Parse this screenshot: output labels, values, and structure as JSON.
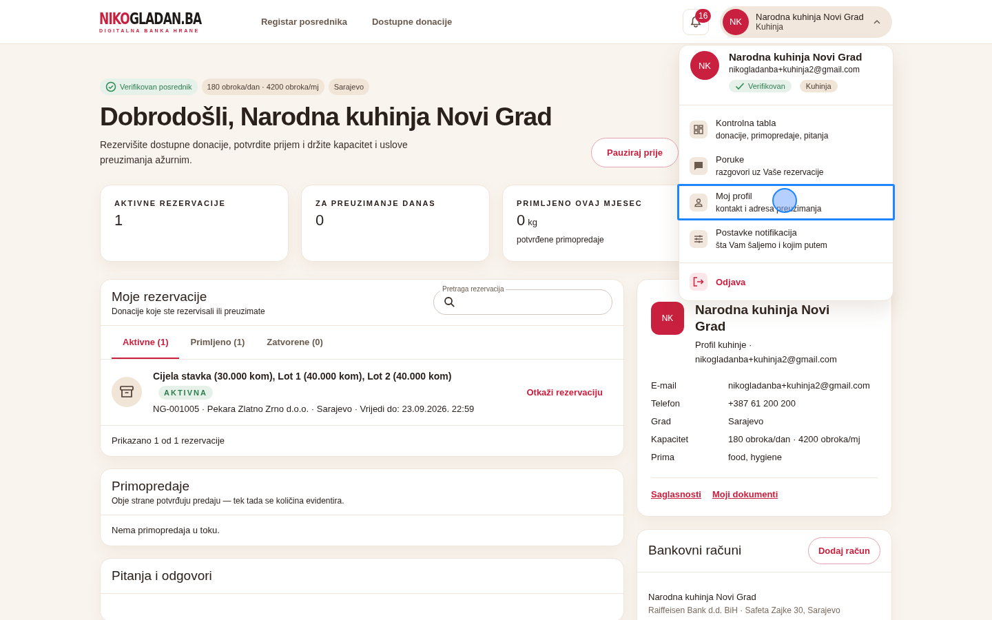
{
  "header": {
    "logo_dark": "NIKO",
    "logo_light": "GLADAN.BA",
    "logo_tagline": "DIGITALNA BANKA HRANE",
    "nav": [
      "Registar posrednika",
      "Dostupne donacije"
    ],
    "notifications_count": "16",
    "account": {
      "initials": "NK",
      "name": "Narodna kuhinja Novi Grad",
      "role": "Kuhinja",
      "expanded": true
    }
  },
  "hero": {
    "badges": [
      {
        "kind": "verified",
        "text": "Verifikovan posrednik"
      },
      {
        "kind": "plain",
        "text": "180 obroka/dan · 4200 obroka/mj"
      },
      {
        "kind": "plain",
        "text": "Sarajevo"
      }
    ],
    "title": "Dobrodošli, Narodna kuhinja Novi Grad",
    "subtitle": "Rezervišite dostupne donacije, potvrdite prijem i držite kapacitet i uslove preuzimanja ažurnim.",
    "button": "Pauziraj prije"
  },
  "stats": [
    {
      "label": "AKTIVNE REZERVACIJE",
      "value": "1"
    },
    {
      "label": "ZA PREUZIMANJE DANAS",
      "value": "0"
    },
    {
      "label": "PRIMLJENO OVAJ MJESEC",
      "value": "0",
      "unit": "kg",
      "note": "potvrđene primopredaje"
    }
  ],
  "reservations": {
    "title": "Moje rezervacije",
    "subtitle": "Donacije koje ste rezervisali ili preuzimate",
    "search": {
      "label": "Pretraga rezervacija"
    },
    "tabs": [
      {
        "label": "Aktivne (1)",
        "selected": true
      },
      {
        "label": "Primljeno (1)",
        "selected": false
      },
      {
        "label": "Zatvorene (0)",
        "selected": false
      }
    ],
    "items": [
      {
        "title": "Cijela stavka (30.000 kom), Lot 1 (40.000 kom), Lot 2 (40.000 kom)",
        "status": "AKTIVNA",
        "meta": "NG-001005 · Pekara Zlatno Zrno d.o.o. · Sarajevo · Vrijedi do: 23.09.2026. 22:59",
        "action": "Otkaži rezervaciju"
      }
    ],
    "footer": "Prikazano 1 od 1 rezervacije"
  },
  "handovers": {
    "title": "Primopredaje",
    "subtitle": "Obje strane potvrđuju predaju — tek tada se količina evidentira.",
    "empty": "Nema primopredaja u toku."
  },
  "qa": {
    "title": "Pitanja i odgovori"
  },
  "profile": {
    "initials": "NK",
    "name": "Narodna kuhinja Novi Grad",
    "subtitle": "Profil kuhinje · nikogladanba+kuhinja2@gmail.com",
    "fields": [
      {
        "label": "E-mail",
        "value": "nikogladanba+kuhinja2@gmail.com"
      },
      {
        "label": "Telefon",
        "value": "+387 61 200 200"
      },
      {
        "label": "Grad",
        "value": "Sarajevo"
      },
      {
        "label": "Kapacitet",
        "value": "180 obroka/dan · 4200 obroka/mj"
      },
      {
        "label": "Prima",
        "value": "food, hygiene"
      }
    ],
    "links": [
      "Saglasnosti",
      "Moji dokumenti"
    ]
  },
  "bank": {
    "title": "Bankovni računi",
    "button": "Dodaj račun",
    "accounts": [
      {
        "name": "Narodna kuhinja Novi Grad",
        "details": "Raiffeisen Bank d.d. BiH · Safeta Zajke 30, Sarajevo"
      }
    ]
  },
  "menu": {
    "initials": "NK",
    "name": "Narodna kuhinja Novi Grad",
    "email": "nikogladanba+kuhinja2@gmail.com",
    "badges": [
      {
        "kind": "verified",
        "text": "Verifikovan"
      },
      {
        "kind": "plain",
        "text": "Kuhinja"
      }
    ],
    "items": [
      {
        "kind": "dashboard",
        "label": "Kontrolna tabla",
        "hint": "donacije, primopredaje, pitanja",
        "selected": false
      },
      {
        "kind": "messages",
        "label": "Poruke",
        "hint": "razgovori uz Vaše rezervacije",
        "selected": false
      },
      {
        "kind": "profile",
        "label": "Moj profil",
        "hint": "kontakt i adresa preuzimanja",
        "selected": true
      },
      {
        "kind": "settings",
        "label": "Postavke notifikacija",
        "hint": "šta Vam šaljemo i kojim putem",
        "selected": false
      }
    ],
    "logout": "Odjava"
  }
}
